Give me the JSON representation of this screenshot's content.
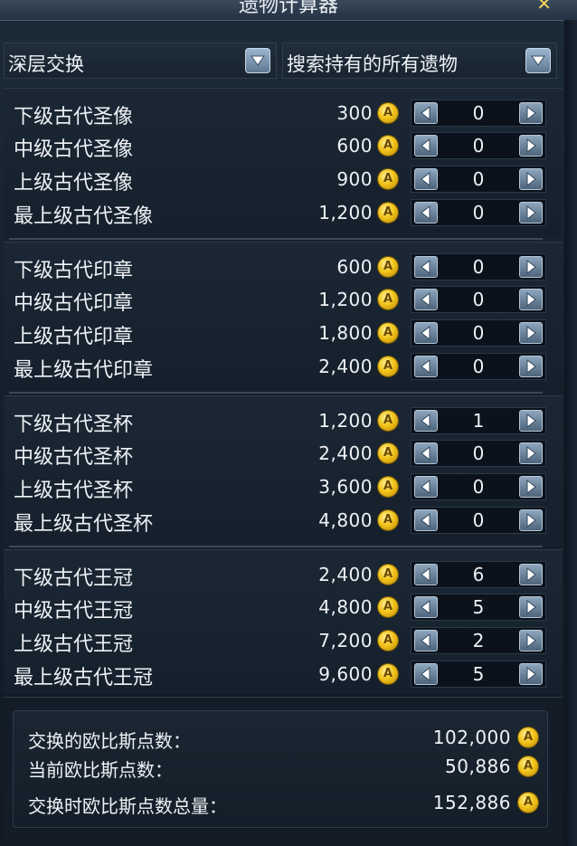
{
  "window": {
    "title": "遗物计算器",
    "close_label": "✕"
  },
  "dropdowns": {
    "mode": "深层交换",
    "filter": "搜索持有的所有遗物"
  },
  "groups": [
    {
      "rows": [
        {
          "name": "下级古代圣像",
          "price": "300",
          "qty": "0"
        },
        {
          "name": "中级古代圣像",
          "price": "600",
          "qty": "0"
        },
        {
          "name": "上级古代圣像",
          "price": "900",
          "qty": "0"
        },
        {
          "name": "最上级古代圣像",
          "price": "1,200",
          "qty": "0"
        }
      ]
    },
    {
      "rows": [
        {
          "name": "下级古代印章",
          "price": "600",
          "qty": "0"
        },
        {
          "name": "中级古代印章",
          "price": "1,200",
          "qty": "0"
        },
        {
          "name": "上级古代印章",
          "price": "1,800",
          "qty": "0"
        },
        {
          "name": "最上级古代印章",
          "price": "2,400",
          "qty": "0"
        }
      ]
    },
    {
      "rows": [
        {
          "name": "下级古代圣杯",
          "price": "1,200",
          "qty": "1"
        },
        {
          "name": "中级古代圣杯",
          "price": "2,400",
          "qty": "0"
        },
        {
          "name": "上级古代圣杯",
          "price": "3,600",
          "qty": "0"
        },
        {
          "name": "最上级古代圣杯",
          "price": "4,800",
          "qty": "0"
        }
      ]
    },
    {
      "rows": [
        {
          "name": "下级古代王冠",
          "price": "2,400",
          "qty": "6"
        },
        {
          "name": "中级古代王冠",
          "price": "4,800",
          "qty": "5"
        },
        {
          "name": "上级古代王冠",
          "price": "7,200",
          "qty": "2"
        },
        {
          "name": "最上级古代王冠",
          "price": "9,600",
          "qty": "5"
        }
      ]
    }
  ],
  "coin_letter": "A",
  "summary": {
    "exchange_label": "交换的欧比斯点数：",
    "exchange_value": "102,000",
    "current_label": "当前欧比斯点数：",
    "current_value": "50,886",
    "total_label": "交换时欧比斯点数总量：",
    "total_value": "152,886"
  },
  "colors": {
    "coin": "#f2c41a",
    "background": "#15202c",
    "text": "#eef2f6"
  }
}
